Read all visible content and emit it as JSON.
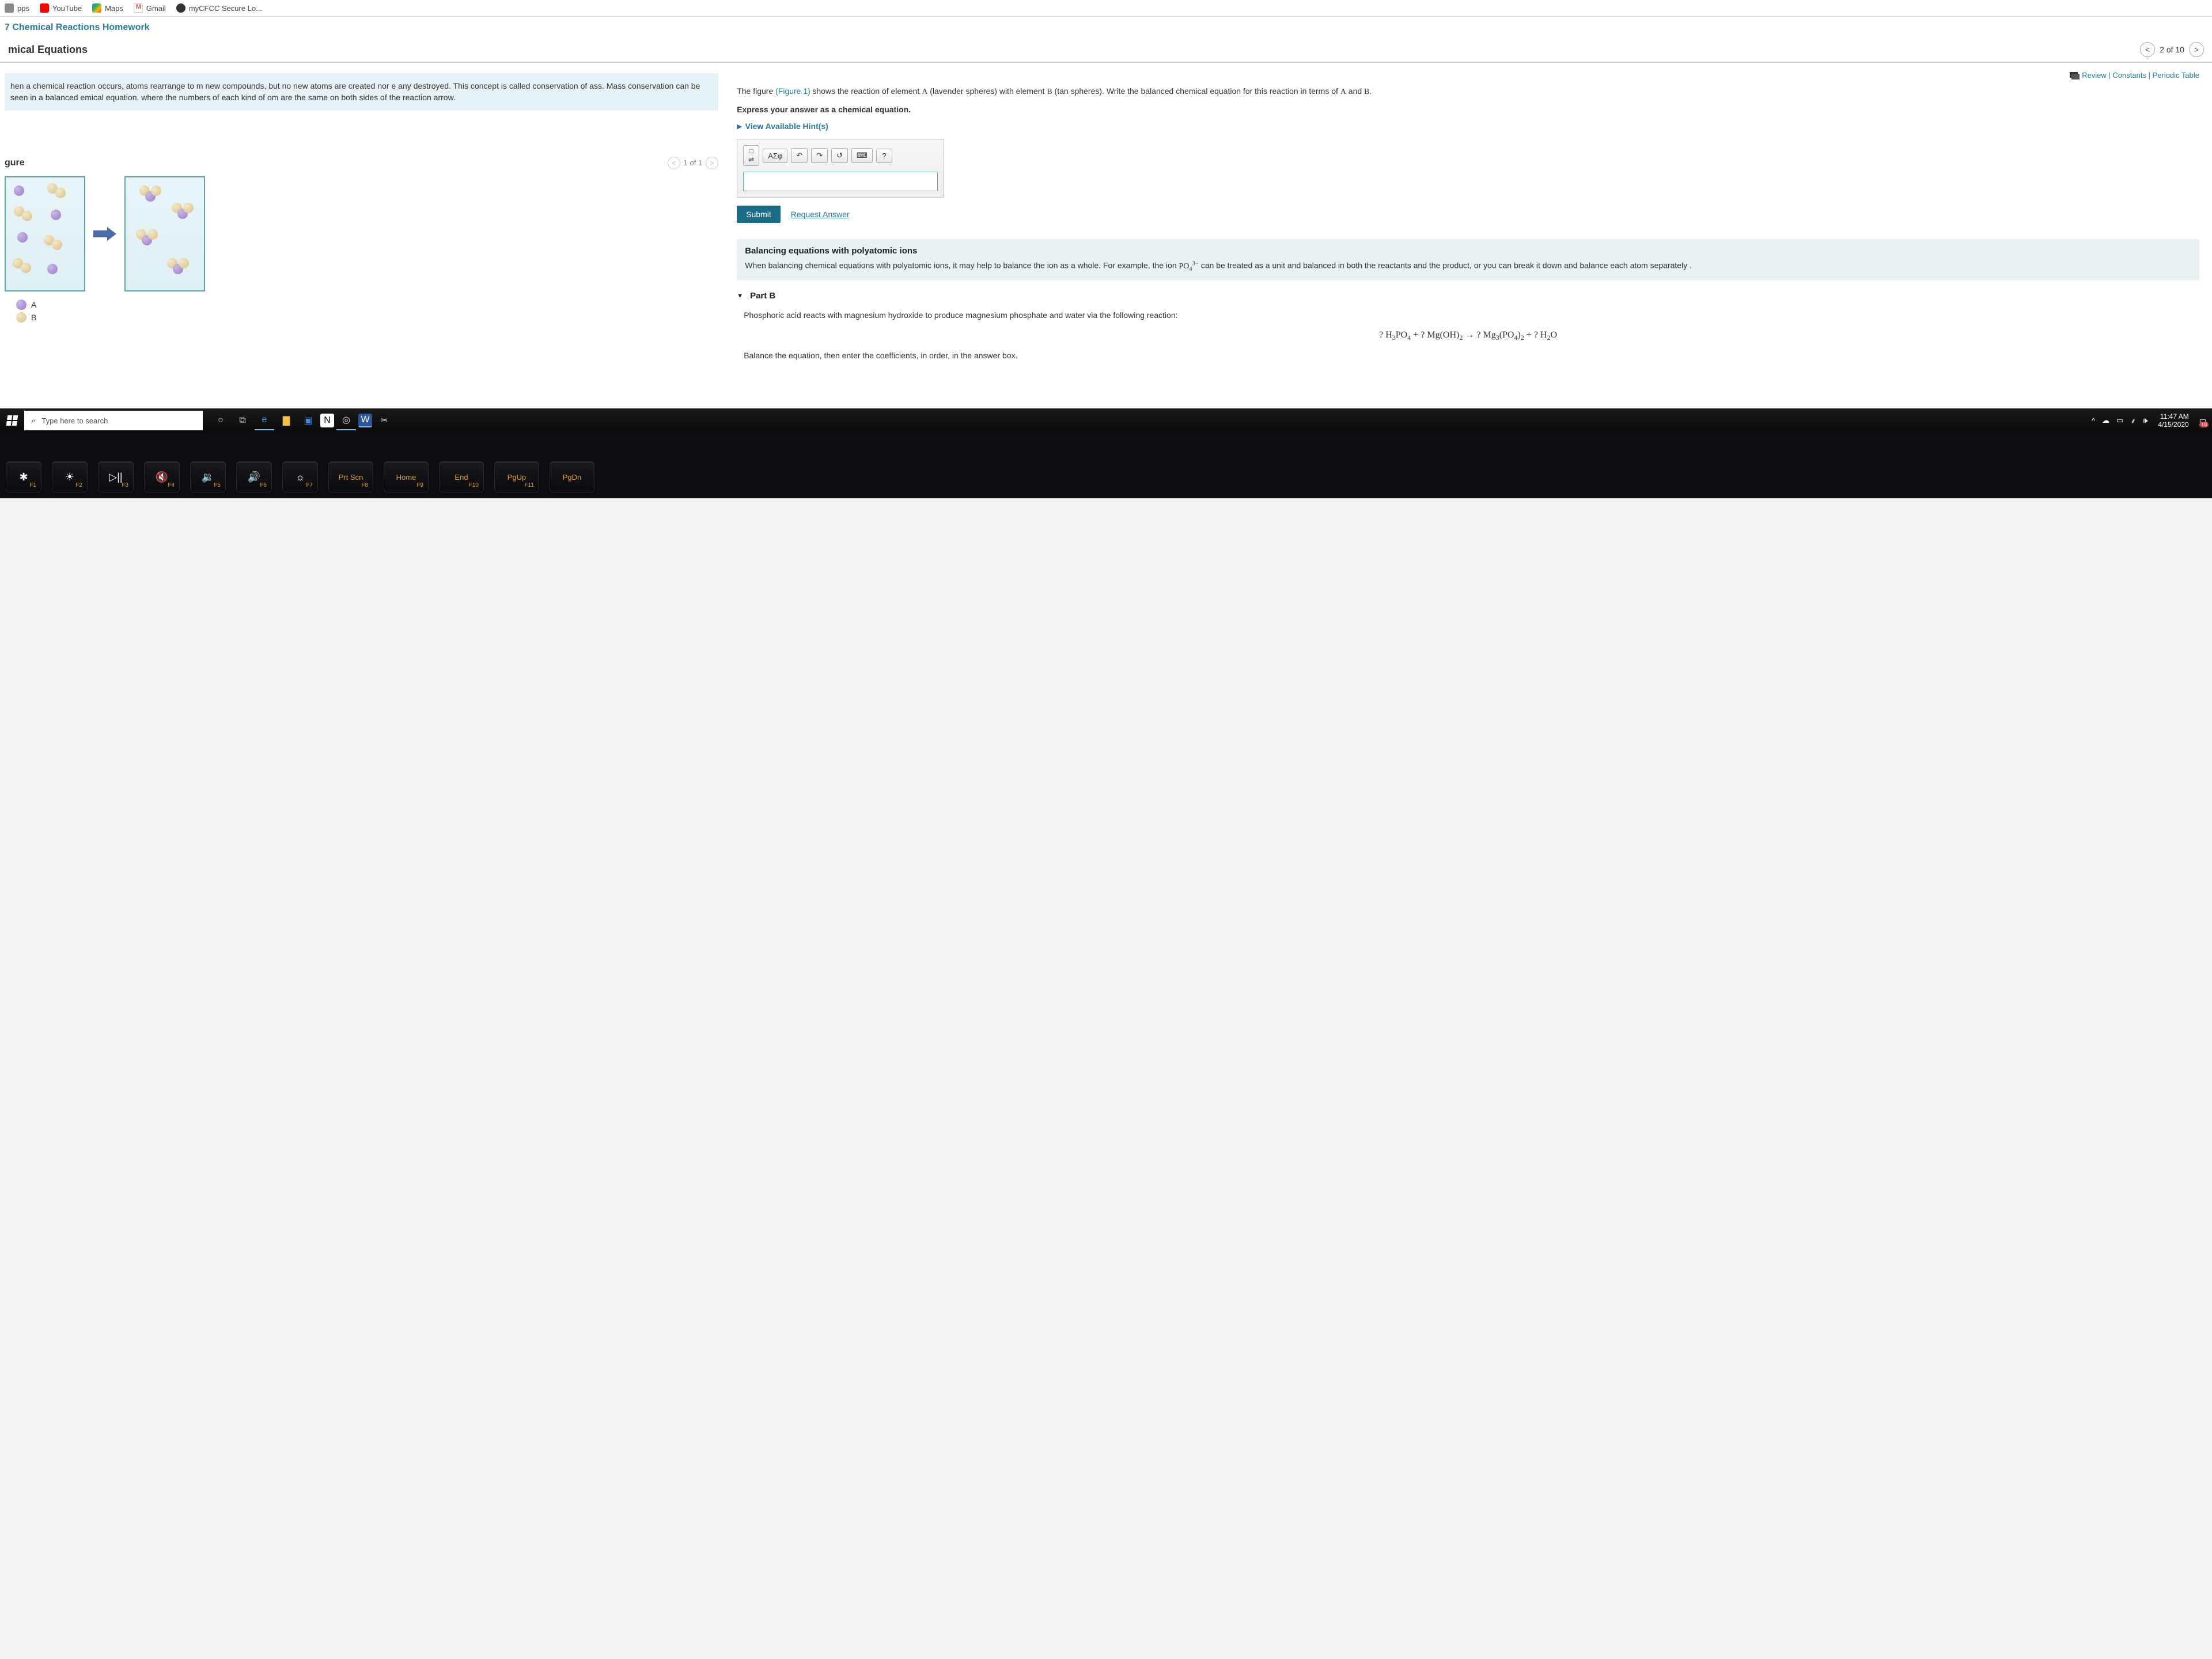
{
  "bookmarks": {
    "apps": "pps",
    "youtube": "YouTube",
    "maps": "Maps",
    "gmail": "Gmail",
    "cfcc": "myCFCC Secure Lo..."
  },
  "assignment": "7 Chemical Reactions Homework",
  "section": "mical Equations",
  "nav": {
    "counter": "2 of 10"
  },
  "top_links": {
    "review": "Review",
    "constants": "Constants",
    "periodic": "Periodic Table"
  },
  "intro": "hen a chemical reaction occurs, atoms rearrange to m new compounds, but no new atoms are created nor e any destroyed. This concept is called conservation of ass. Mass conservation can be seen in a balanced emical equation, where the numbers of each kind of om are the same on both sides of the reaction arrow.",
  "figure": {
    "title": "gure",
    "counter": "1 of 1",
    "legendA": "A",
    "legendB": "B"
  },
  "partA": {
    "prompt_pre": "The figure ",
    "fig_link": "(Figure 1)",
    "prompt_post": " shows the reaction of element A (lavender spheres) with element B (tan spheres). Write the balanced chemical equation for this reaction in terms of A and B.",
    "express": "Express your answer as a chemical equation.",
    "hints": "View Available Hint(s)",
    "toolbar": {
      "greek": "ΑΣφ",
      "help": "?"
    },
    "submit": "Submit",
    "request": "Request Answer"
  },
  "infobox": {
    "title": "Balancing equations with polyatomic ions",
    "body_pre": "When balancing chemical equations with polyatomic ions, it may help to balance the ion as a whole. For example, the ion ",
    "ion": "PO₄³⁻",
    "body_post": " can be treated as a unit and balanced in both the reactants and the product, or you can break it down and balance each atom separately ."
  },
  "partB": {
    "title": "Part B",
    "prompt": "Phosphoric acid reacts with magnesium hydroxide to produce magnesium phosphate and water via the following reaction:",
    "equation": "? H₃PO₄ + ? Mg(OH)₂ → ? Mg₃(PO₄)₂ + ? H₂O",
    "balance": "Balance the equation, then enter the coefficients, in order, in the answer box."
  },
  "taskbar": {
    "search_placeholder": "Type here to search",
    "time": "11:47 AM",
    "date": "4/15/2020",
    "badge": "18"
  },
  "keys": {
    "f1": "F1",
    "f2": "F2",
    "f3": "F3",
    "f4": "F4",
    "f5": "F5",
    "f6": "F6",
    "f7": "F7",
    "prtscn": "Prt Scn",
    "f8": "F8",
    "home": "Home",
    "f9": "F9",
    "end": "End",
    "f10": "F10",
    "pgup": "PgUp",
    "f11": "F11",
    "pgdn": "PgDn"
  }
}
